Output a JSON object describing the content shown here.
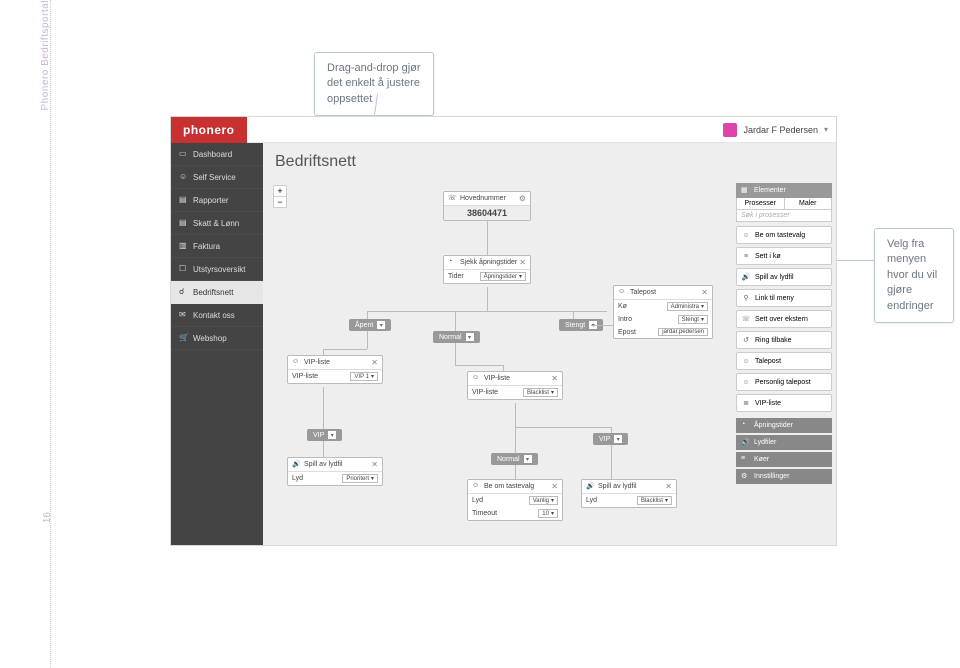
{
  "doc": {
    "side_label": "Phonero Bedriftsportal",
    "page_number": "16"
  },
  "callouts": {
    "top": "Drag-and-drop gjør det enkelt å justere oppsettet",
    "right": "Velg fra menyen hvor du vil gjøre endringer"
  },
  "header": {
    "logo": "phonero",
    "user_name": "Jardar F Pedersen"
  },
  "sidebar": {
    "items": [
      {
        "label": "Dashboard"
      },
      {
        "label": "Self Service"
      },
      {
        "label": "Rapporter"
      },
      {
        "label": "Skatt & Lønn"
      },
      {
        "label": "Faktura"
      },
      {
        "label": "Utstyrsoversikt"
      },
      {
        "label": "Bedriftsnett"
      },
      {
        "label": "Kontakt oss"
      },
      {
        "label": "Webshop"
      }
    ]
  },
  "page": {
    "title": "Bedriftsnett"
  },
  "zoom": {
    "plus": "+",
    "minus": "−"
  },
  "panel": {
    "head": "Elementer",
    "tabs": [
      "Prosesser",
      "Maler"
    ],
    "search_ph": "Søk i prosesser",
    "items": [
      "Be om tastevalg",
      "Sett i kø",
      "Spill av lydfil",
      "Link til meny",
      "Sett over ekstern",
      "Ring tilbake",
      "Talepost",
      "Personlig talepost",
      "VIP-liste"
    ],
    "foot": [
      "Åpningstider",
      "Lydfiler",
      "Køer",
      "Innstillinger"
    ]
  },
  "flow": {
    "hovednummer": {
      "title": "Hovednummer",
      "number": "38604471"
    },
    "sjekk": {
      "title": "Sjekk åpningstider",
      "label": "Tider",
      "value": "Åpningstider"
    },
    "apent": "Åpent",
    "normal1": "Normal",
    "stengt": "Stengt",
    "vip1": {
      "title": "VIP-liste",
      "label": "VIP-liste",
      "value": "VIP 1"
    },
    "vip2": {
      "title": "VIP-liste",
      "label": "VIP-liste",
      "value": "Blacklist"
    },
    "vip_pill": "VIP",
    "normal_pill": "Normal",
    "vip_pill2": "VIP",
    "spill1": {
      "title": "Spill av lydfil",
      "label": "Lyd",
      "value": "Prioritert"
    },
    "beom": {
      "title": "Be om tastevalg",
      "label": "Lyd",
      "value": "Vanlig",
      "label2": "Timeout",
      "value2": "10"
    },
    "spill2": {
      "title": "Spill av lydfil",
      "label": "Lyd",
      "value": "Blacklist"
    },
    "talepost": {
      "title": "Talepost",
      "label": "Kø",
      "value": "Administra",
      "label2": "Intro",
      "value2": "Stengt",
      "label3": "Epost",
      "value3": "jardar.pedersen"
    }
  }
}
